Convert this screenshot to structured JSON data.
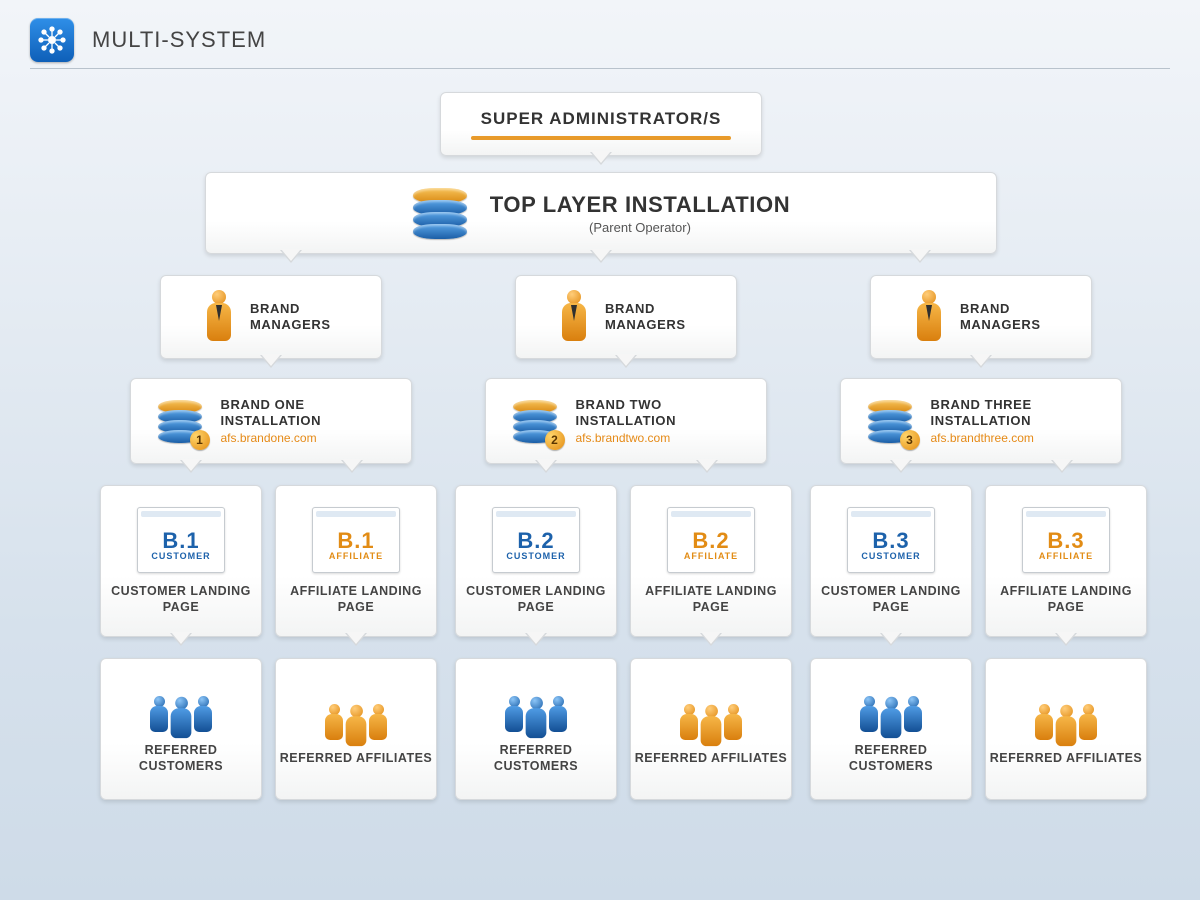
{
  "header": {
    "title": "MULTI-SYSTEM"
  },
  "super_admin": {
    "title": "SUPER  ADMINISTRATOR/S"
  },
  "top_layer": {
    "title": "TOP LAYER INSTALLATION",
    "subtitle": "(Parent Operator)"
  },
  "brand_manager_label": "BRAND MANAGERS",
  "customer_landing_label": "CUSTOMER LANDING PAGE",
  "affiliate_landing_label": "AFFILIATE LANDING PAGE",
  "referred_customers_label": "REFERRED CUSTOMERS",
  "referred_affiliates_label": "REFERRED AFFILIATES",
  "page_role_customer": "CUSTOMER",
  "page_role_affiliate": "AFFILIATE",
  "brands": [
    {
      "badge": "1",
      "code": "B.1",
      "install_title": "BRAND ONE INSTALLATION",
      "url": "afs.brandone.com"
    },
    {
      "badge": "2",
      "code": "B.2",
      "install_title": "BRAND TWO INSTALLATION",
      "url": "afs.brandtwo.com"
    },
    {
      "badge": "3",
      "code": "B.3",
      "install_title": "BRAND THREE INSTALLATION",
      "url": "afs.brandthree.com"
    }
  ],
  "colors": {
    "accent_orange": "#e58a17",
    "accent_blue": "#1d62ab"
  }
}
